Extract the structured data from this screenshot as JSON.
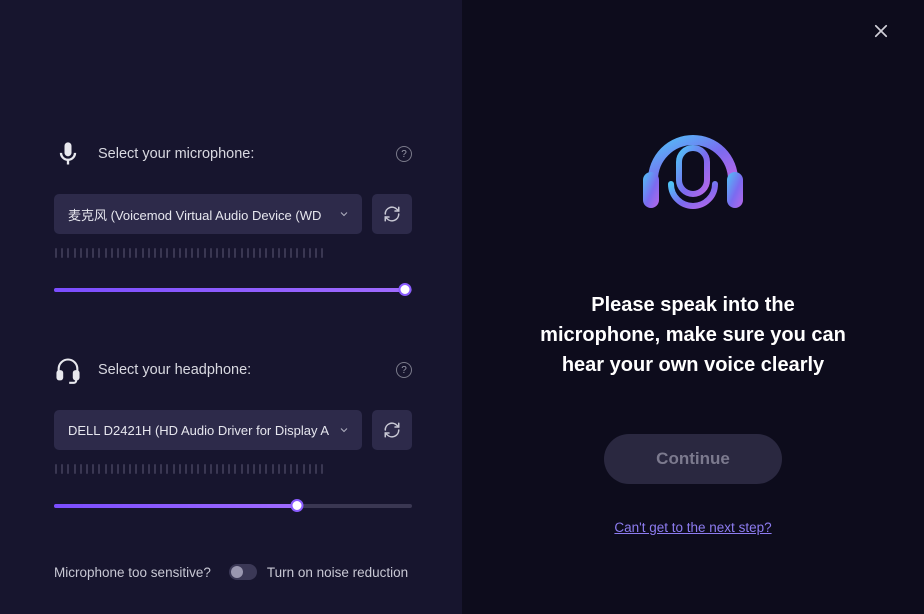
{
  "microphone": {
    "label": "Select your microphone:",
    "selected": "麦克风 (Voicemod Virtual Audio Device (WD",
    "slider_percent": 98
  },
  "headphone": {
    "label": "Select your headphone:",
    "selected": "DELL D2421H (HD Audio Driver for Display A",
    "slider_percent": 68
  },
  "noise": {
    "question": "Microphone too sensitive?",
    "action": "Turn on noise reduction"
  },
  "right": {
    "instruction": "Please speak into the microphone, make sure you can hear your own voice clearly",
    "continue": "Continue",
    "help_link": "Can't get to the next step?"
  }
}
